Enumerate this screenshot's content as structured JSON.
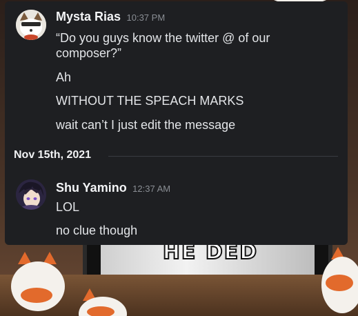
{
  "messages": [
    {
      "author": "Mysta Rias",
      "time": "10:37 PM",
      "avatar_icon": "fox-avatar-icon",
      "lines": [
        "“Do you guys know the twitter @ of our composer?”",
        "Ah",
        "WITHOUT THE SPEACH MARKS",
        "wait can’t I just edit the message"
      ]
    },
    {
      "author": "Shu Yamino",
      "time": "12:37 AM",
      "avatar_icon": "shu-avatar-icon",
      "lines": [
        "LOL",
        "no clue though"
      ]
    }
  ],
  "date_divider": "Nov 15th, 2021",
  "background": {
    "caption": "HE DED"
  },
  "colors": {
    "panel": "#1e1f22",
    "username": "#f2f3f5",
    "timestamp": "#8a8e94",
    "text": "#e3e5e8"
  }
}
